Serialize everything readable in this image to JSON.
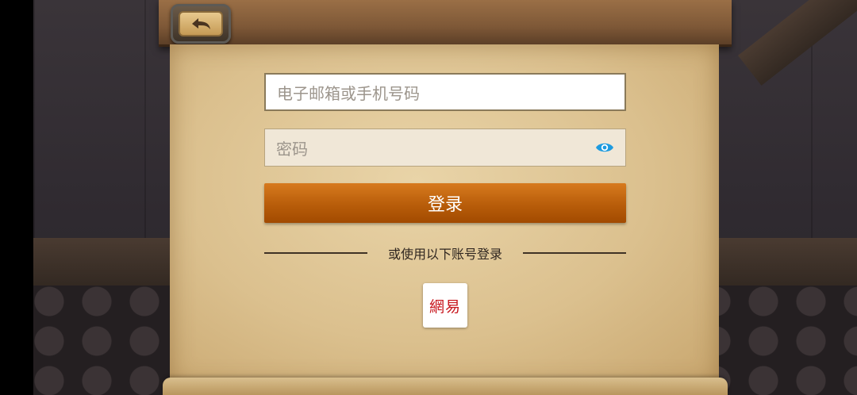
{
  "header": {
    "back_icon": "back-arrow-icon"
  },
  "login_form": {
    "account_placeholder": "电子邮箱或手机号码",
    "password_placeholder": "密码",
    "password_toggle_icon": "eye-icon",
    "login_label": "登录",
    "divider_text": "或使用以下账号登录",
    "providers": [
      {
        "label": "網易"
      }
    ]
  },
  "colors": {
    "login_button": "#b85d0a",
    "eye_icon": "#1d9be0",
    "provider_text": "#c8161d"
  }
}
